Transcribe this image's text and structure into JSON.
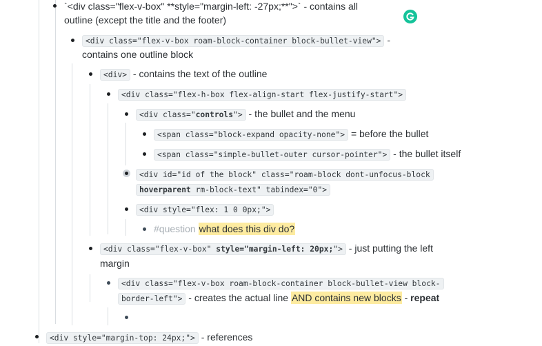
{
  "outline": {
    "l1_a": "`<div class=\"flex-v-box\" **style=\"margin-left: -27px;**\">` - contains all",
    "l1_b": "outline (except the title and the footer)",
    "l2_code": "<div class=\"flex-v-box roam-block-container block-bullet-view\">",
    "l2_dash": " -",
    "l2_desc": "contains one outline block",
    "l3_code": "<div>",
    "l3_desc": " - contains the text of the outline",
    "l4_code": "<div class=\"flex-h-box flex-align-start flex-justify-start\">",
    "l5_code_pre": "<div class=\"",
    "l5_code_bold": "controls",
    "l5_code_post": "\">",
    "l5_desc": " - the bullet and the menu",
    "l6a_code": "<span class=\"block-expand opacity-none\">",
    "l6a_desc": " = before the bullet",
    "l6b_code": "<span class=\"simple-bullet-outer cursor-pointer\">",
    "l6b_desc": " - the bullet itself",
    "l5b_code1": "<div id=\"id of the block\" class=\"roam-block dont-unfocus-block",
    "l5b_code2_bold": "hoverparent",
    "l5b_code2_post": " rm-block-text\" tabindex=\"0\">",
    "l5c_code": "<div style=\"flex: 1 0 0px;\">",
    "l6c_tag": "#question",
    "l6c_hl": "what does this div do?",
    "l3b_code_pre": "<div class=\"flex-v-box\" ",
    "l3b_code_bold": "style=\"margin-left: 20px;",
    "l3b_code_post": "\">",
    "l3b_desc": " - just putting the left",
    "l3b_desc2": "margin",
    "l4b_code1": "<div class=\"flex-v-box roam-block-container block-bullet-view block-",
    "l4b_code2": "border-left\">",
    "l4b_desc": " - creates the actual line ",
    "l4b_hl": "AND contains new blocks",
    "l4b_dash": " - ",
    "l4b_bold": "repeat",
    "l1b_code": "<div style=\"margin-top: 24px;\">",
    "l1b_desc": " - references"
  },
  "icons": {
    "grammarly": "grammarly-icon"
  },
  "colors": {
    "highlight": "#fdeba0",
    "grammarly": "#15c39a",
    "tag": "#a9b0b6"
  }
}
